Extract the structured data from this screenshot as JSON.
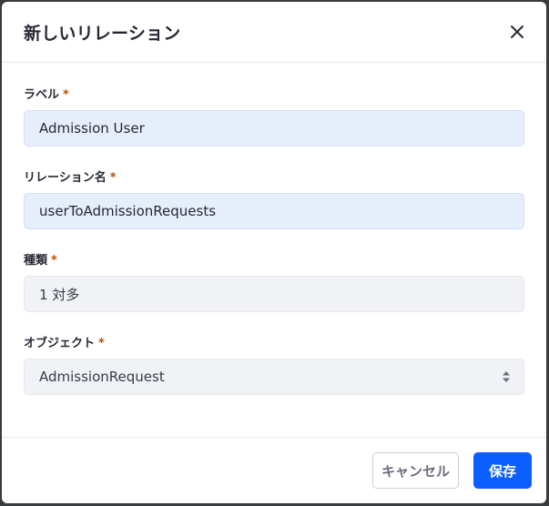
{
  "modal": {
    "title": "新しいリレーション"
  },
  "form": {
    "required_mark": "*",
    "label_field": {
      "label": "ラベル",
      "value": "Admission User"
    },
    "relation_name_field": {
      "label": "リレーション名",
      "value": "userToAdmissionRequests"
    },
    "type_field": {
      "label": "種類",
      "value": "1 対多"
    },
    "object_field": {
      "label": "オブジェクト",
      "value": "AdmissionRequest"
    }
  },
  "footer": {
    "cancel_label": "キャンセル",
    "save_label": "保存"
  },
  "colors": {
    "primary": "#0b5fff",
    "required": "#b95000",
    "input_blue_bg": "#e6eefc",
    "input_gray_bg": "#f1f2f5"
  }
}
